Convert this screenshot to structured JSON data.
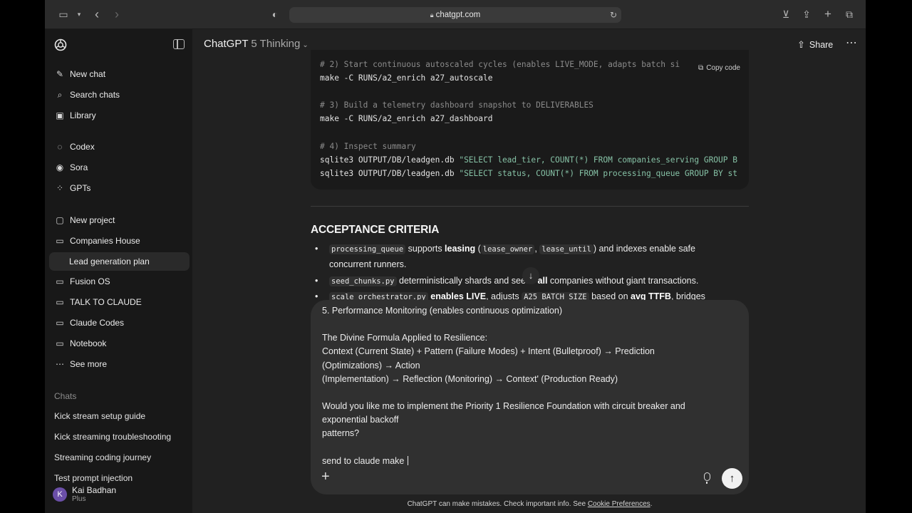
{
  "browser": {
    "url": "chatgpt.com"
  },
  "sidebar": {
    "primary": [
      {
        "label": "New chat",
        "icon": "edit-icon"
      },
      {
        "label": "Search chats",
        "icon": "search-icon"
      },
      {
        "label": "Library",
        "icon": "library-icon"
      }
    ],
    "apps": [
      {
        "label": "Codex",
        "icon": "codex-icon"
      },
      {
        "label": "Sora",
        "icon": "sora-icon"
      },
      {
        "label": "GPTs",
        "icon": "gpts-icon"
      }
    ],
    "projects": [
      {
        "label": "New project",
        "icon": "folder-plus-icon"
      },
      {
        "label": "Companies House",
        "icon": "folder-icon"
      },
      {
        "label": "Lead generation plan",
        "icon": ""
      },
      {
        "label": "Fusion OS",
        "icon": "folder-icon"
      },
      {
        "label": "TALK TO CLAUDE",
        "icon": "folder-icon"
      },
      {
        "label": "Claude Codes",
        "icon": "folder-icon"
      },
      {
        "label": "Notebook",
        "icon": "folder-icon"
      },
      {
        "label": "See more",
        "icon": "ellipsis-icon"
      }
    ],
    "chats_label": "Chats",
    "chats": [
      "Kick stream setup guide",
      "Kick streaming troubleshooting",
      "Streaming coding journey",
      "Test prompt injection"
    ],
    "user": {
      "initial": "K",
      "name": "Kai Badhan",
      "plan": "Plus"
    }
  },
  "header": {
    "title": "ChatGPT",
    "model": "5 Thinking",
    "share_label": "Share"
  },
  "code_block": {
    "copy_label": "Copy code",
    "lines": [
      {
        "type": "comment",
        "text": "# 2) Start continuous autoscaled cycles (enables LIVE_MODE, adapts batch si"
      },
      {
        "type": "code",
        "text": "make -C RUNS/a2_enrich a27_autoscale"
      },
      {
        "type": "comment",
        "text": "# 3) Build a telemetry dashboard snapshot to DELIVERABLES"
      },
      {
        "type": "code",
        "text": "make -C RUNS/a2_enrich a27_dashboard"
      },
      {
        "type": "comment",
        "text": "# 4) Inspect summary"
      },
      {
        "type": "sql",
        "cmd": "sqlite3 OUTPUT/DB/leadgen.db ",
        "str": "\"SELECT lead_tier, COUNT(*) FROM companies_serving GROUP B"
      },
      {
        "type": "sql",
        "cmd": "sqlite3 OUTPUT/DB/leadgen.db ",
        "str": "\"SELECT status, COUNT(*) FROM processing_queue GROUP BY st"
      }
    ]
  },
  "acceptance": {
    "heading": "ACCEPTANCE CRITERIA",
    "b1": {
      "code1": "processing_queue",
      "t1": " supports ",
      "bold1": "leasing",
      "t2": " (",
      "code2": "lease_owner",
      "t3": ", ",
      "code3": "lease_until",
      "t4": ") and indexes enable safe",
      "cont": "concurrent runners."
    },
    "b2": {
      "code1": "seed_chunks.py",
      "t1": " deterministically shards and seeds ",
      "bold1": "all",
      "t2": " companies without giant transactions."
    },
    "b3": {
      "code1": "scale_orchestrator.py",
      "t1": " ",
      "bold1": "enables LIVE",
      "t2": ", adjusts ",
      "code2": "A25_BATCH_SIZE",
      "t3": " based on ",
      "bold2": "avg TTFB",
      "t4": ", bridges"
    }
  },
  "composer": {
    "lines": [
      "  5. Performance Monitoring (enables continuous optimization)",
      "  The Divine Formula Applied to Resilience:",
      "  Context (Current State) + Pattern (Failure Modes) + Intent (Bulletproof) → Prediction",
      "(Optimizations) → Action",
      "  (Implementation) → Reflection (Monitoring) → Context' (Production Ready)",
      "  Would you like me to implement the Priority 1 Resilience Foundation with circuit breaker and",
      "exponential backoff",
      "   patterns?",
      "send to claude make "
    ]
  },
  "footer": {
    "text": "ChatGPT can make mistakes. Check important info. See ",
    "link": "Cookie Preferences",
    "end": "."
  }
}
